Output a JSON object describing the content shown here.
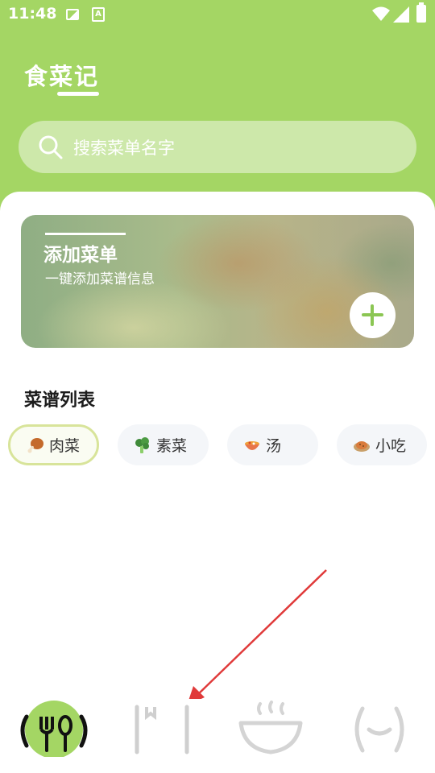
{
  "status_bar": {
    "time": "11:48",
    "icons": [
      "image-icon",
      "a-text-icon",
      "wifi-icon",
      "signal-icon",
      "battery-charging-icon"
    ]
  },
  "header": {
    "title": "食菜记",
    "search_placeholder": "搜索菜单名字"
  },
  "add_card": {
    "title": "添加菜单",
    "subtitle": "一键添加菜谱信息",
    "button_icon": "plus-icon"
  },
  "recipe_section": {
    "title": "菜谱列表",
    "categories": [
      {
        "label": "肉菜",
        "icon": "drumstick-icon",
        "active": true
      },
      {
        "label": "素菜",
        "icon": "broccoli-icon",
        "active": false
      },
      {
        "label": "汤",
        "icon": "soup-bowl-icon",
        "active": false
      },
      {
        "label": "小吃",
        "icon": "dumpling-icon",
        "active": false
      }
    ]
  },
  "bottom_nav": {
    "items": [
      {
        "icon": "utensils-icon",
        "active": true
      },
      {
        "icon": "bookmark-book-icon",
        "active": false
      },
      {
        "icon": "steaming-bowl-icon",
        "active": false
      },
      {
        "icon": "smiley-face-icon",
        "active": false
      }
    ]
  },
  "colors": {
    "accent": "#a4d664",
    "accent_dark": "#8bc653",
    "arrow": "#e03a3a",
    "chip_active_border": "#d8e49a"
  }
}
